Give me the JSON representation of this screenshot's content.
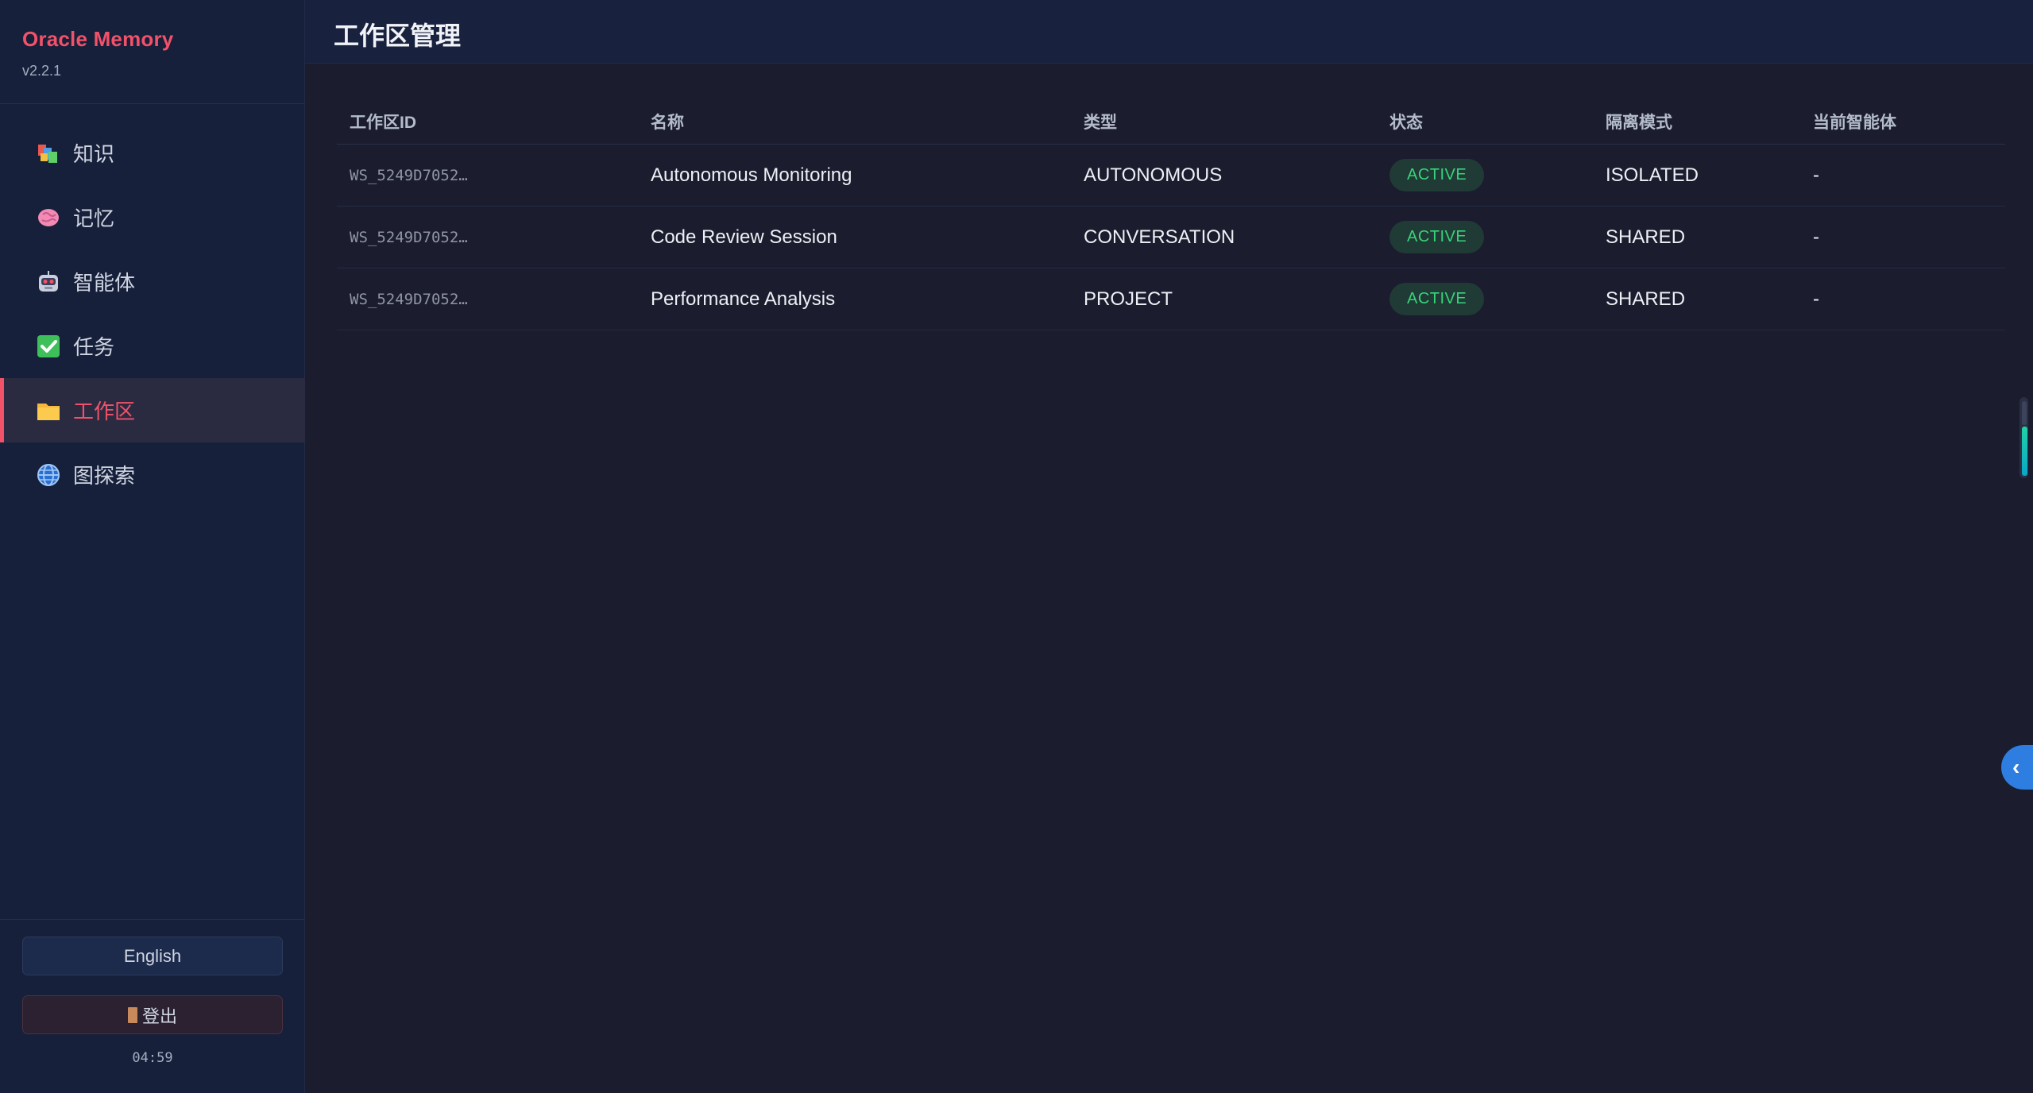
{
  "brand": {
    "title": "Oracle Memory",
    "version": "v2.2.1"
  },
  "sidebar": {
    "items": [
      {
        "label": "知识",
        "icon": "books-icon"
      },
      {
        "label": "记忆",
        "icon": "brain-icon"
      },
      {
        "label": "智能体",
        "icon": "robot-icon"
      },
      {
        "label": "任务",
        "icon": "checkmark-icon"
      },
      {
        "label": "工作区",
        "icon": "folder-icon",
        "active": true
      },
      {
        "label": "图探索",
        "icon": "globe-icon"
      }
    ],
    "language_label": "English",
    "logout_label": "登出",
    "clock": "04:59"
  },
  "header": {
    "title": "工作区管理"
  },
  "table": {
    "columns": [
      "工作区ID",
      "名称",
      "类型",
      "状态",
      "隔离模式",
      "当前智能体"
    ],
    "rows": [
      {
        "id": "WS_5249D7052…",
        "name": "Autonomous Monitoring",
        "type": "AUTONOMOUS",
        "status": "ACTIVE",
        "isolation": "ISOLATED",
        "agent": "-"
      },
      {
        "id": "WS_5249D7052…",
        "name": "Code Review Session",
        "type": "CONVERSATION",
        "status": "ACTIVE",
        "isolation": "SHARED",
        "agent": "-"
      },
      {
        "id": "WS_5249D7052…",
        "name": "Performance Analysis",
        "type": "PROJECT",
        "status": "ACTIVE",
        "isolation": "SHARED",
        "agent": "-"
      }
    ]
  },
  "colors": {
    "accent": "#f2516a",
    "status_active": "#38d37a",
    "collapse_button": "#2e7de0"
  },
  "right_panel": {
    "toggle_icon": "chevron-left-icon"
  }
}
